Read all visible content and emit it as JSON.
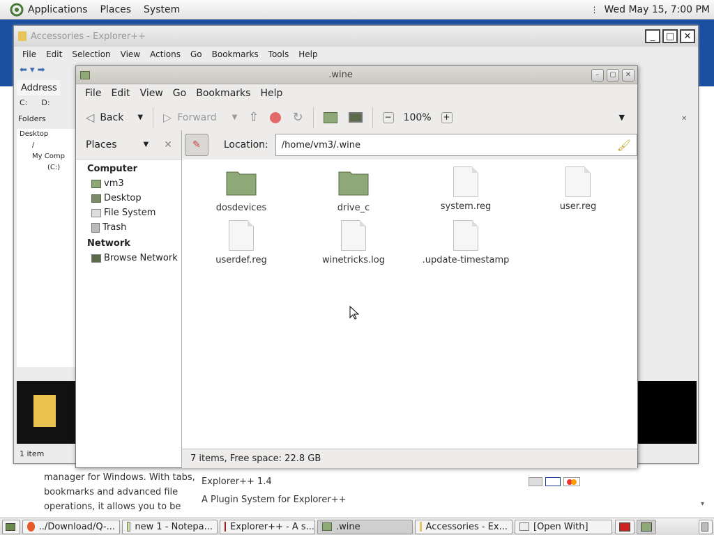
{
  "top_panel": {
    "menus": [
      "Applications",
      "Places",
      "System"
    ],
    "clock": "Wed May 15,  7:00 PM"
  },
  "bg_page": {
    "text_lines": [
      "manager for Windows. With tabs,",
      "bookmarks and advanced file",
      "operations, it allows you to be"
    ],
    "links": [
      "Explorer++ 1.4",
      "A Plugin System for Explorer++"
    ]
  },
  "explorer": {
    "title": "Accessories - Explorer++",
    "menus": [
      "File",
      "Edit",
      "Selection",
      "View",
      "Actions",
      "Go",
      "Bookmarks",
      "Tools",
      "Help"
    ],
    "address_label": "Address",
    "drives": [
      "C:",
      "D:"
    ],
    "folders_label": "Folders",
    "tree": [
      "Desktop",
      "/",
      "My Comp",
      "(C:)"
    ],
    "status": "1 item"
  },
  "nautilus": {
    "title": ".wine",
    "menus": [
      "File",
      "Edit",
      "View",
      "Go",
      "Bookmarks",
      "Help"
    ],
    "toolbar": {
      "back": "Back",
      "forward": "Forward",
      "zoom": "100%"
    },
    "location_label": "Location:",
    "location_value": "/home/vm3/.wine",
    "sidebar": {
      "header": "Places",
      "computer_heading": "Computer",
      "computer_items": [
        "vm3",
        "Desktop",
        "File System",
        "Trash"
      ],
      "network_heading": "Network",
      "network_items": [
        "Browse Network"
      ]
    },
    "files": [
      {
        "name": "dosdevices",
        "kind": "folder"
      },
      {
        "name": "drive_c",
        "kind": "folder"
      },
      {
        "name": "system.reg",
        "kind": "file"
      },
      {
        "name": "user.reg",
        "kind": "file"
      },
      {
        "name": "userdef.reg",
        "kind": "file"
      },
      {
        "name": "winetricks.log",
        "kind": "file"
      },
      {
        "name": ".update-timestamp",
        "kind": "file"
      }
    ],
    "status": "7 items, Free space: 22.8 GB"
  },
  "taskbar": {
    "tasks": [
      "../Download/Q-...",
      "new 1 - Notepa...",
      "Explorer++ - A s...",
      ".wine",
      "Accessories - Ex...",
      "[Open With]"
    ]
  },
  "colors": {
    "folder": "#8fa877",
    "page_header": "#1b4fa0"
  }
}
